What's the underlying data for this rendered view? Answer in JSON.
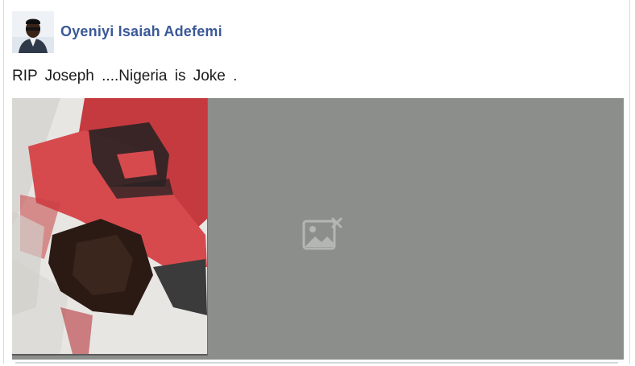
{
  "post": {
    "author_name": "Oyeniyi Isaiah Adefemi",
    "text": "RIP  Joseph ....Nigeria  is  Joke .",
    "media": {
      "photo_icon": "person-photo",
      "broken_image_icon": "broken-image-icon"
    }
  },
  "colors": {
    "author_link": "#3b5998",
    "media_placeholder_bg": "#8c8e8c",
    "card_border": "#d9dadd"
  }
}
